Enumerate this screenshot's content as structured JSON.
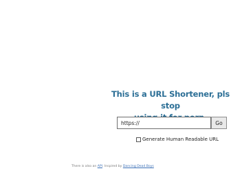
{
  "headline": {
    "line1": "This is a URL Shortener, pls stop",
    "line2": "using it for porn."
  },
  "form": {
    "url_value": "https://",
    "go_label": "Go",
    "option_label": "Generate Human Readable URL",
    "option_checked": false
  },
  "footer": {
    "prefix": "There is also an ",
    "api_link": "API",
    "middle": ". Inspired by ",
    "credit_link": "Dancing Dead Boys"
  },
  "colors": {
    "headline": "#2c6f96",
    "link": "#3b6fb6",
    "background": "#ffffff"
  }
}
